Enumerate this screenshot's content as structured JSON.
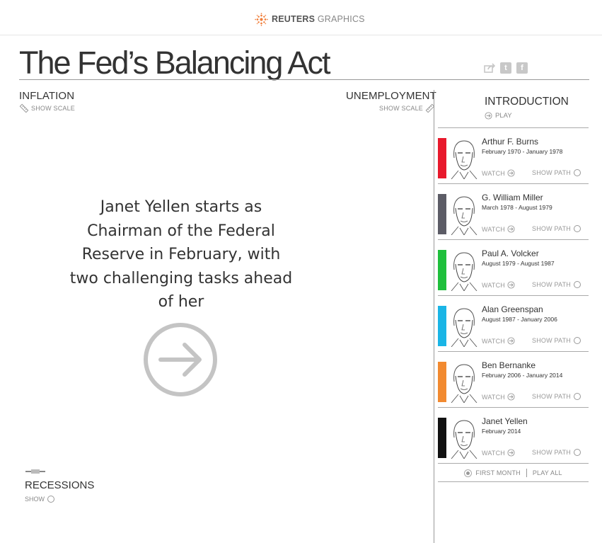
{
  "header": {
    "brand_bold": "REUTERS",
    "brand_light": " GRAPHICS",
    "title": "The Fed’s Balancing Act"
  },
  "share": {
    "icons": [
      "share-icon",
      "twitter-icon",
      "facebook-icon"
    ],
    "twitter_glyph": "t",
    "facebook_glyph": "f"
  },
  "chart": {
    "inflation_label": "INFLATION",
    "inflation_scale": "SHOW SCALE",
    "unemployment_label": "UNEMPLOYMENT",
    "unemployment_scale": "SHOW SCALE",
    "intro_text": "Janet Yellen starts as Chairman of the Federal Reserve in February, with two challenging tasks ahead of her",
    "recessions_label": "RECESSIONS",
    "recessions_show": "SHOW"
  },
  "sidebar": {
    "intro_heading": "INTRODUCTION",
    "intro_play": "PLAY",
    "chairs": [
      {
        "name": "Arthur F. Burns",
        "dates": "February 1970 - January 1978",
        "color": "#e8192c",
        "watch": "WATCH",
        "show_path": "SHOW PATH"
      },
      {
        "name": "G. William Miller",
        "dates": "March 1978 - August 1979",
        "color": "#5c5c66",
        "watch": "WATCH",
        "show_path": "SHOW PATH"
      },
      {
        "name": "Paul A. Volcker",
        "dates": "August 1979 - August 1987",
        "color": "#1fbf3c",
        "watch": "WATCH",
        "show_path": "SHOW PATH"
      },
      {
        "name": "Alan Greenspan",
        "dates": "August 1987 - January 2006",
        "color": "#1ab5e6",
        "watch": "WATCH",
        "show_path": "SHOW PATH"
      },
      {
        "name": "Ben Bernanke",
        "dates": "February 2006 - January 2014",
        "color": "#f28a30",
        "watch": "WATCH",
        "show_path": "SHOW PATH"
      },
      {
        "name": "Janet Yellen",
        "dates": "February 2014",
        "color": "#111111",
        "watch": "WATCH",
        "show_path": "SHOW PATH"
      }
    ],
    "first_month": "FIRST MONTH",
    "play_all": "PLAY ALL"
  },
  "colors": {
    "accent_orange": "#f07e3a",
    "rule": "#999999",
    "muted_text": "#888888"
  }
}
